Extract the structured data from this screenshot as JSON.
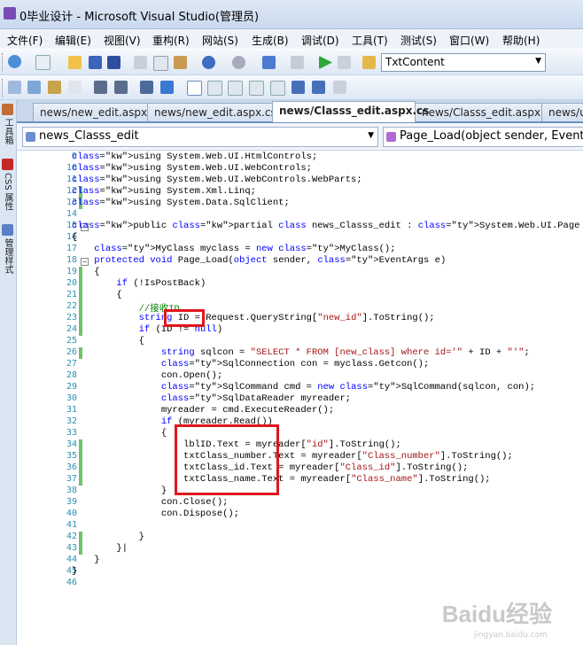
{
  "window": {
    "title": "0毕业设计 - Microsoft Visual Studio(管理员)"
  },
  "menu": [
    "文件(F)",
    "编辑(E)",
    "视图(V)",
    "重构(R)",
    "网站(S)",
    "生成(B)",
    "调试(D)",
    "工具(T)",
    "测试(S)",
    "窗口(W)",
    "帮助(H)"
  ],
  "toolbar": {
    "find_combo_value": "TxtContent"
  },
  "side_toolbox": [
    "工具箱",
    "CSS 属性",
    "管理样式"
  ],
  "tabs": [
    {
      "label": "news/new_edit.aspx",
      "active": false
    },
    {
      "label": "news/new_edit.aspx.cs",
      "active": false
    },
    {
      "label": "news/Classs_edit.aspx.cs",
      "active": true
    },
    {
      "label": "news/Classs_edit.aspx",
      "active": false
    },
    {
      "label": "news/u",
      "active": false
    }
  ],
  "nav": {
    "class_combo": "news_Classs_edit",
    "member_combo": "Page_Load(object sender, EventArgs"
  },
  "code_lines": [
    {
      "n": "9",
      "t": "using System.Web.UI.HtmlControls;"
    },
    {
      "n": "10",
      "t": "using System.Web.UI.WebControls;"
    },
    {
      "n": "11",
      "t": "using System.Web.UI.WebControls.WebParts;"
    },
    {
      "n": "12",
      "t": "using System.Xml.Linq;"
    },
    {
      "n": "13",
      "t": "using System.Data.SqlClient;"
    },
    {
      "n": "14",
      "t": ""
    },
    {
      "n": "15",
      "t": "public partial class news_Classs_edit : System.Web.UI.Page"
    },
    {
      "n": "16",
      "t": "{"
    },
    {
      "n": "17",
      "t": "    MyClass myclass = new MyClass();"
    },
    {
      "n": "18",
      "t": "    protected void Page_Load(object sender, EventArgs e)"
    },
    {
      "n": "19",
      "t": "    {"
    },
    {
      "n": "20",
      "t": "        if (!IsPostBack)"
    },
    {
      "n": "21",
      "t": "        {"
    },
    {
      "n": "22",
      "t": "            //接收ID"
    },
    {
      "n": "23",
      "t": "            string ID = Request.QueryString[\"new_id\"].ToString();"
    },
    {
      "n": "24",
      "t": "            if (ID != null)"
    },
    {
      "n": "25",
      "t": "            {"
    },
    {
      "n": "26",
      "t": "                string sqlcon = \"SELECT * FROM [new_class] where id='\" + ID + \"'\";"
    },
    {
      "n": "27",
      "t": "                SqlConnection con = myclass.Getcon();"
    },
    {
      "n": "28",
      "t": "                con.Open();"
    },
    {
      "n": "29",
      "t": "                SqlCommand cmd = new SqlCommand(sqlcon, con);"
    },
    {
      "n": "30",
      "t": "                SqlDataReader myreader;"
    },
    {
      "n": "31",
      "t": "                myreader = cmd.ExecuteReader();"
    },
    {
      "n": "32",
      "t": "                if (myreader.Read())"
    },
    {
      "n": "33",
      "t": "                {"
    },
    {
      "n": "34",
      "t": "                    lblID.Text = myreader[\"id\"].ToString();"
    },
    {
      "n": "35",
      "t": "                    txtClass_number.Text = myreader[\"Class_number\"].ToString();"
    },
    {
      "n": "36",
      "t": "                    txtClass_id.Text = myreader[\"Class_id\"].ToString();"
    },
    {
      "n": "37",
      "t": "                    txtClass_name.Text = myreader[\"Class_name\"].ToString();"
    },
    {
      "n": "38",
      "t": "                }"
    },
    {
      "n": "39",
      "t": "                con.Close();"
    },
    {
      "n": "40",
      "t": "                con.Dispose();"
    },
    {
      "n": "41",
      "t": ""
    },
    {
      "n": "42",
      "t": "            }"
    },
    {
      "n": "43",
      "t": "        }|"
    },
    {
      "n": "44",
      "t": "    }"
    },
    {
      "n": "45",
      "t": "}"
    },
    {
      "n": "46",
      "t": ""
    }
  ],
  "watermark": {
    "text": "Baidu经验",
    "sub": "jingyan.baidu.com"
  },
  "colors": {
    "keyword": "#0000ff",
    "type": "#2b91af",
    "string": "#a31515",
    "comment": "#008000",
    "highlight_box": "#e0161d"
  }
}
